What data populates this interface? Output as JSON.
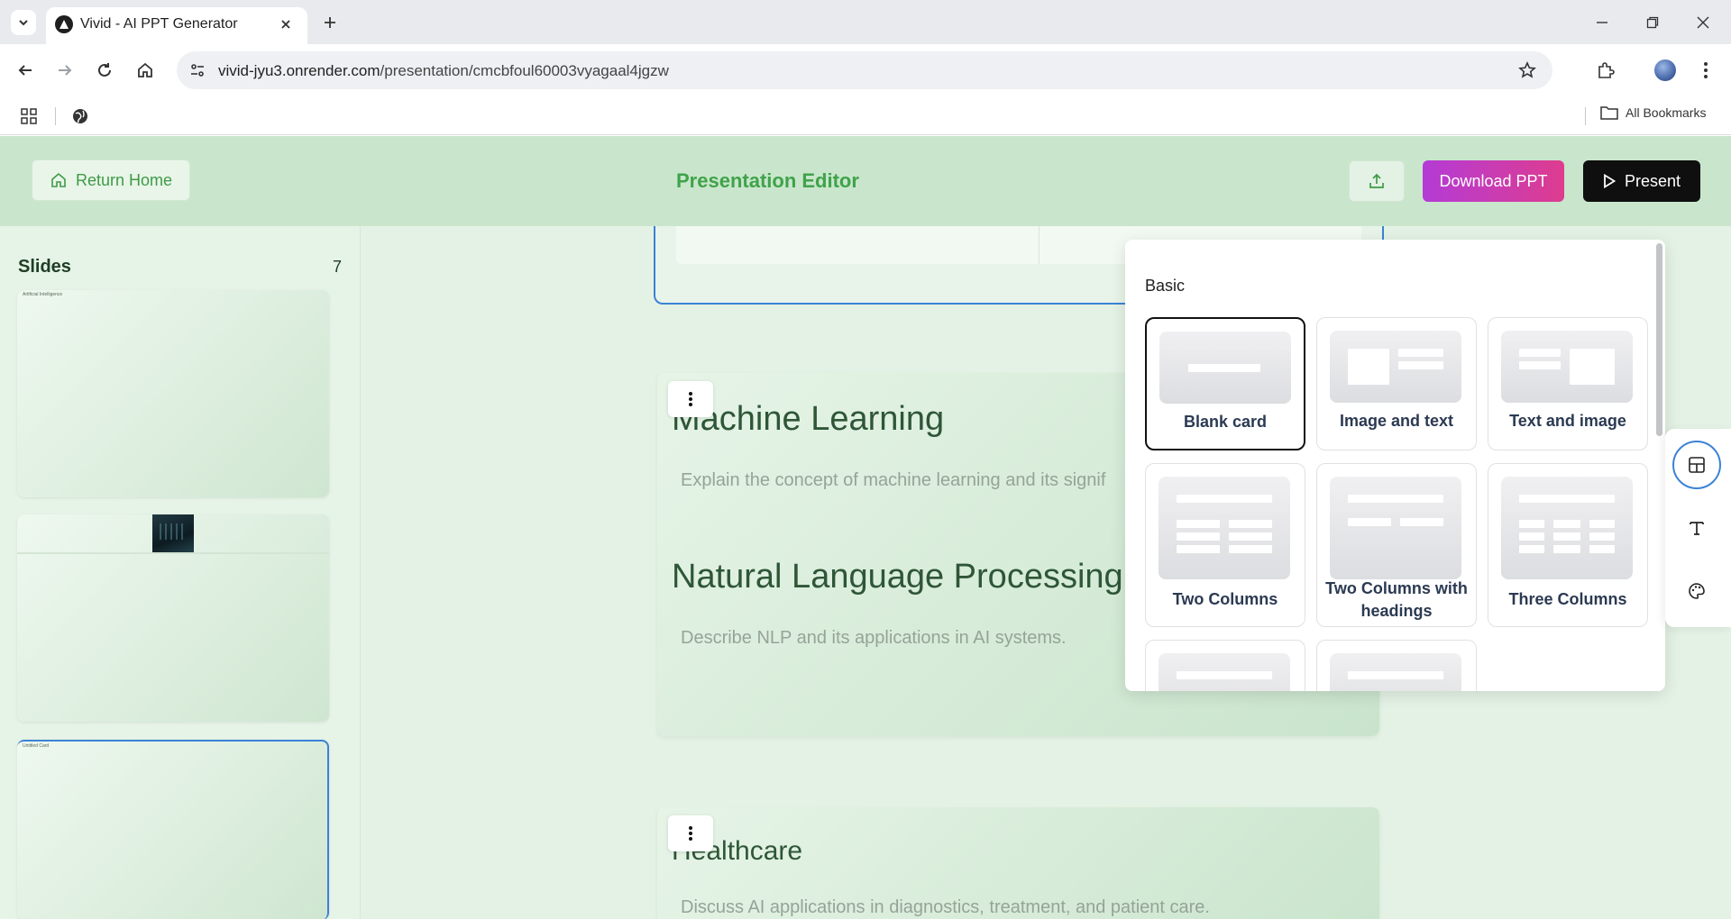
{
  "browser": {
    "tab_title": "Vivid - AI PPT Generator",
    "url_host": "vivid-jyu3.onrender.com",
    "url_path": "/presentation/cmcbfoul60003vyagaal4jgzw",
    "bookmarks_all": "All Bookmarks"
  },
  "header": {
    "return_home": "Return Home",
    "title": "Presentation Editor",
    "download": "Download PPT",
    "present": "Present"
  },
  "sidebar": {
    "title": "Slides",
    "count": "7",
    "thumbs": [
      {
        "label": "Artificial Intelligence"
      },
      {
        "label": ""
      },
      {
        "label": "Untitled Card"
      }
    ]
  },
  "cards": [
    {
      "heading1": "Machine Learning",
      "desc1": "Explain the concept of machine learning and its signif",
      "heading2": "Natural Language Processing",
      "desc2": "Describe NLP and its applications in AI systems."
    },
    {
      "heading1": "Healthcare",
      "desc1": "Discuss AI applications in diagnostics, treatment, and patient care."
    }
  ],
  "layout_panel": {
    "heading": "Basic",
    "layouts": [
      {
        "label": "Blank card",
        "selected": true
      },
      {
        "label": "Image and text"
      },
      {
        "label": "Text and image"
      },
      {
        "label": "Two Columns"
      },
      {
        "label": "Two Columns with headings"
      },
      {
        "label": "Three Columns"
      }
    ]
  },
  "icons": {
    "layout_tool": "layout-icon",
    "text_tool": "text-icon",
    "theme_tool": "palette-icon"
  },
  "colors": {
    "header_bg": "#c9e6cc",
    "accent_green": "#3fa34a",
    "download_gradient_start": "#b43bd6",
    "download_gradient_end": "#de3c8e",
    "present_bg": "#0f0f0f",
    "selection_blue": "#3b82d6"
  }
}
